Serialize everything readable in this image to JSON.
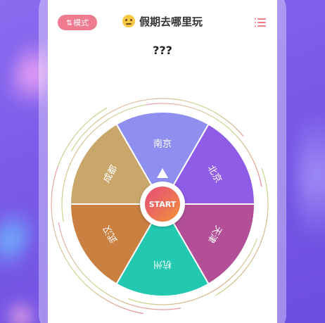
{
  "header": {
    "mode_label": "模式",
    "mode_icon": "swap-arrows-icon",
    "title": "假期去哪里玩",
    "title_emoji": "thinking-face-icon",
    "menu_icon": "list-menu-icon",
    "accent_color": "#f07a8e"
  },
  "result": {
    "text": "???"
  },
  "wheel": {
    "start_label": "START",
    "segments": [
      {
        "label": "南京",
        "color": "#8f8ff0"
      },
      {
        "label": "北京",
        "color": "#8e5ce6"
      },
      {
        "label": "天津",
        "color": "#b24f97"
      },
      {
        "label": "杭州",
        "color": "#22c8b0"
      },
      {
        "label": "武汉",
        "color": "#c98040"
      },
      {
        "label": "成都",
        "color": "#c9a66a"
      }
    ]
  }
}
